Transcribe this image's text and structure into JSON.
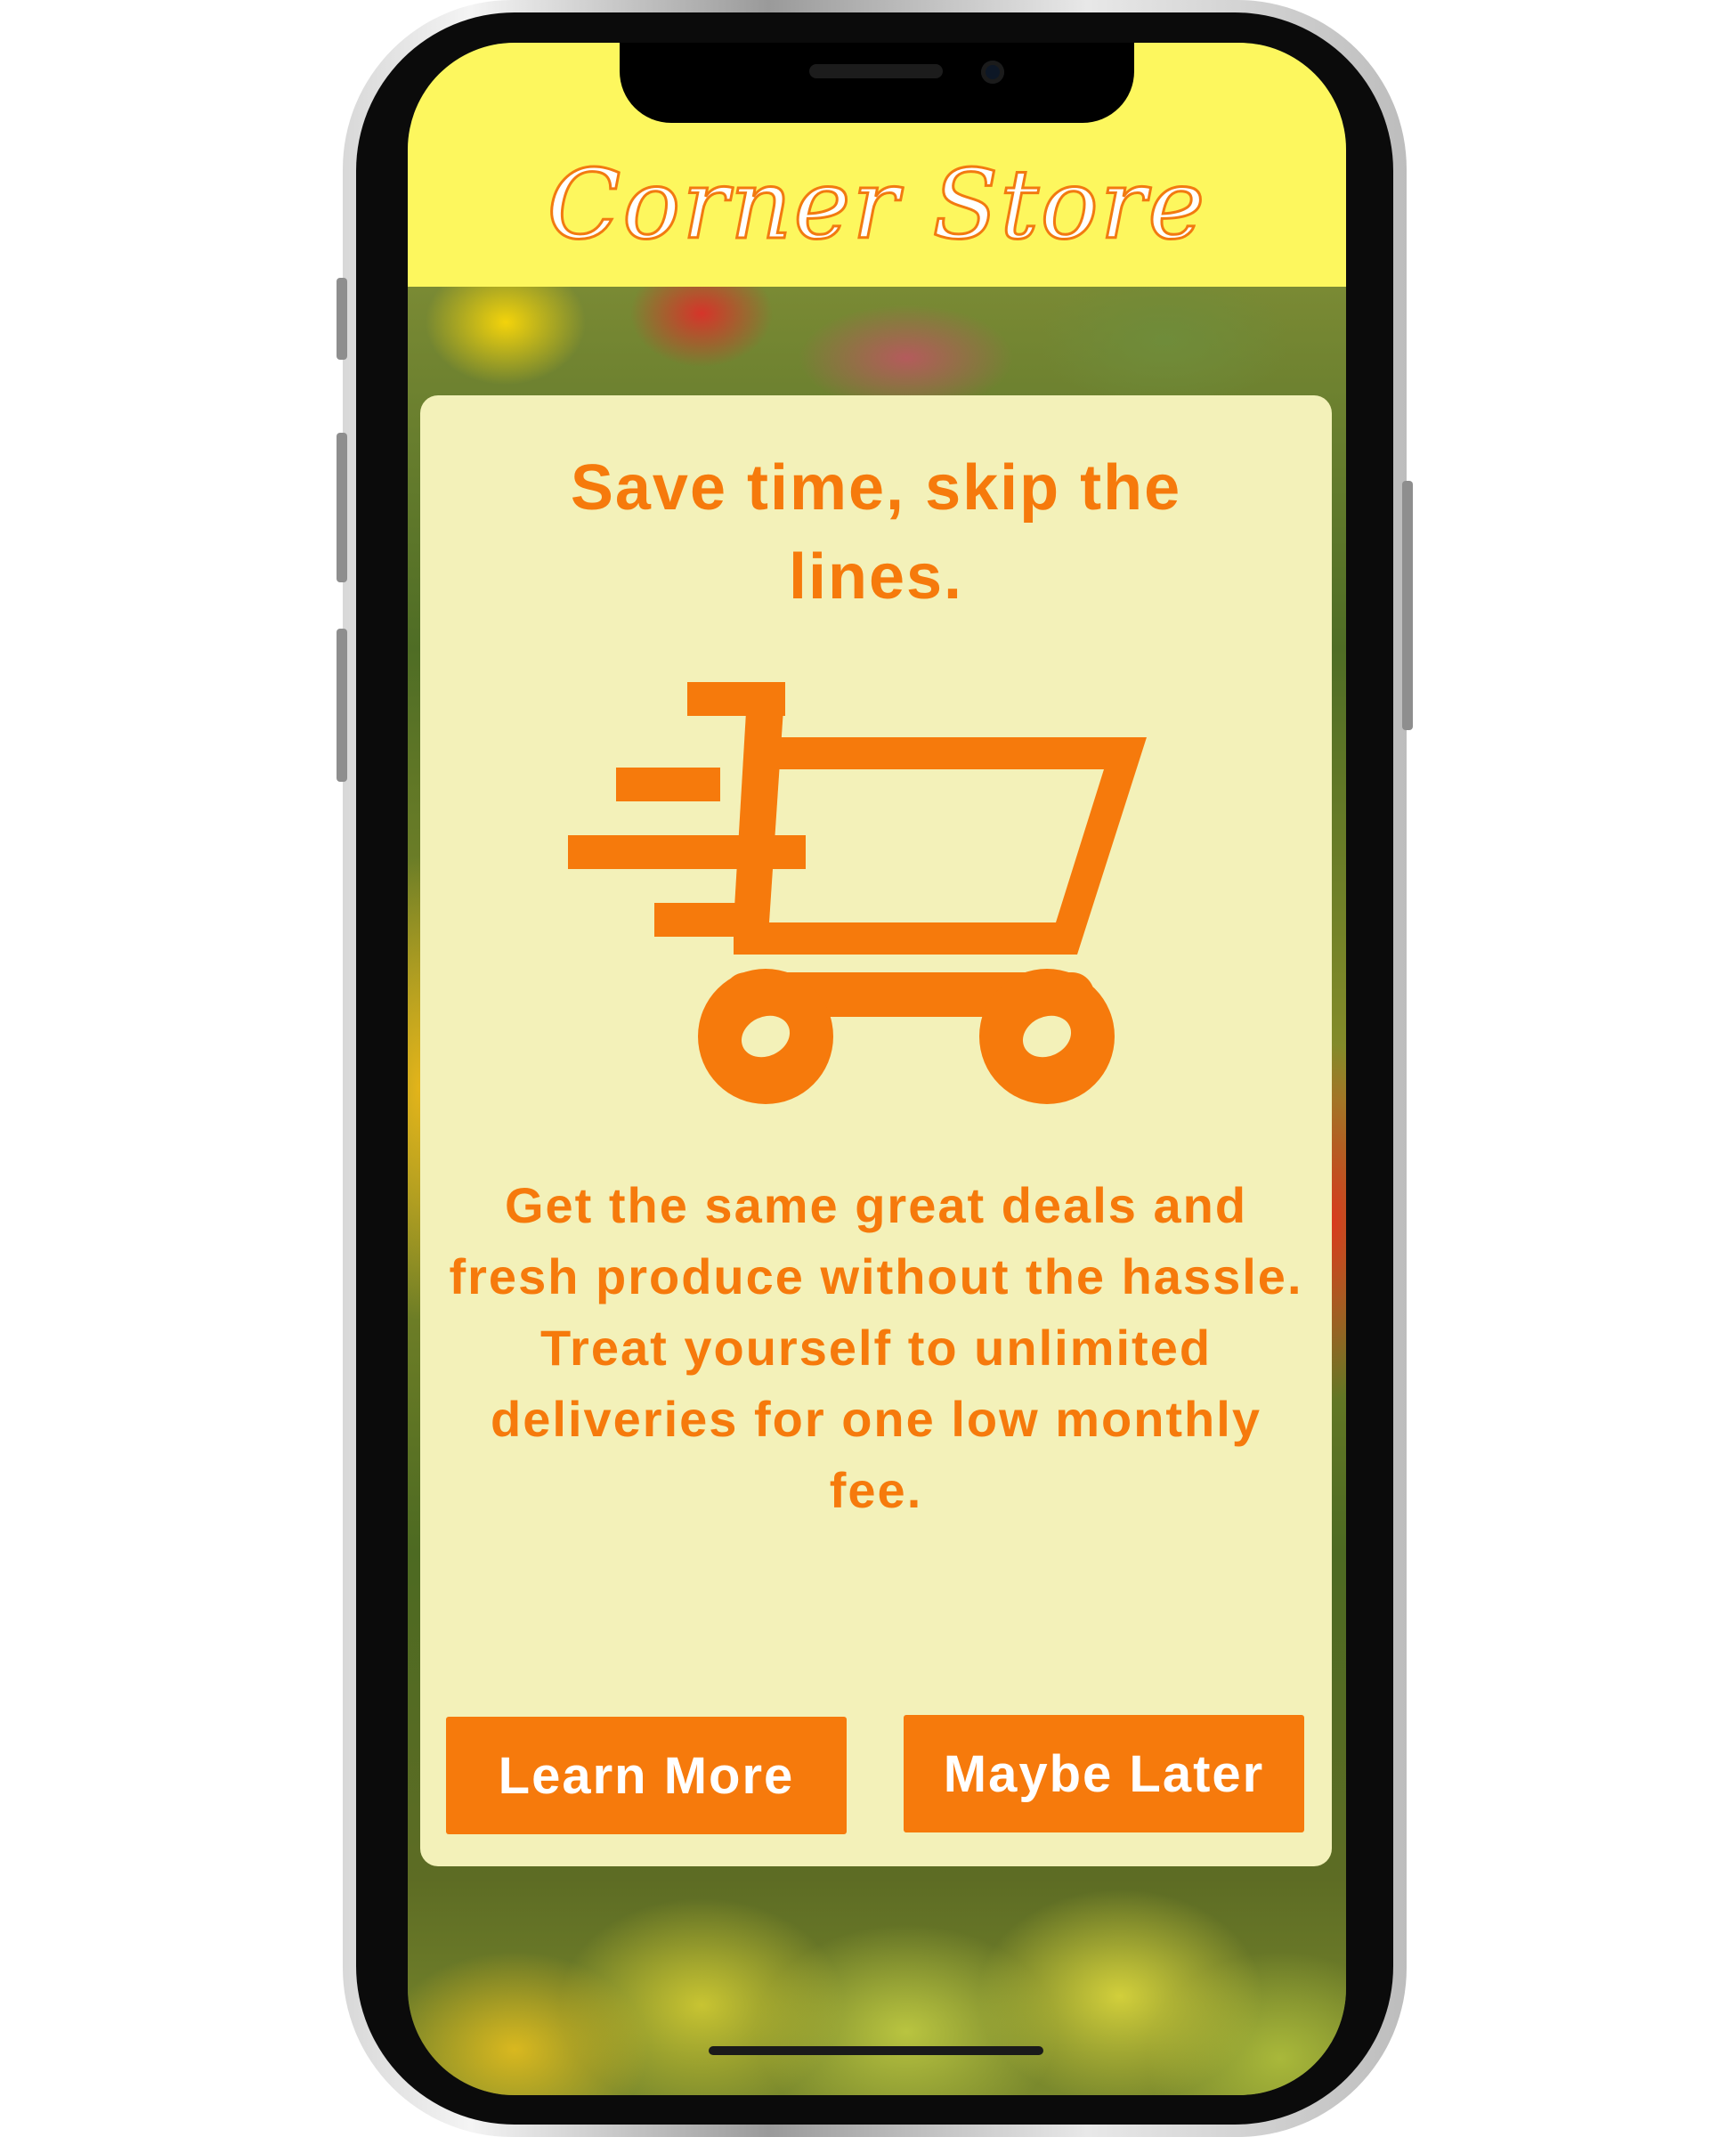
{
  "app": {
    "title": "Corner Store"
  },
  "promo": {
    "headline": "Save time, skip the lines.",
    "icon": "shopping-cart-icon",
    "body": "Get the same great deals and fresh produce without the hassle. Treat yourself to unlimited deliveries for one low monthly fee.",
    "learn_more_label": "Learn More",
    "maybe_later_label": "Maybe Later"
  },
  "colors": {
    "header_background": "#fdf75e",
    "accent_orange": "#f67a0c",
    "card_background": "#f3f1b9",
    "button_text": "#ffffff"
  }
}
